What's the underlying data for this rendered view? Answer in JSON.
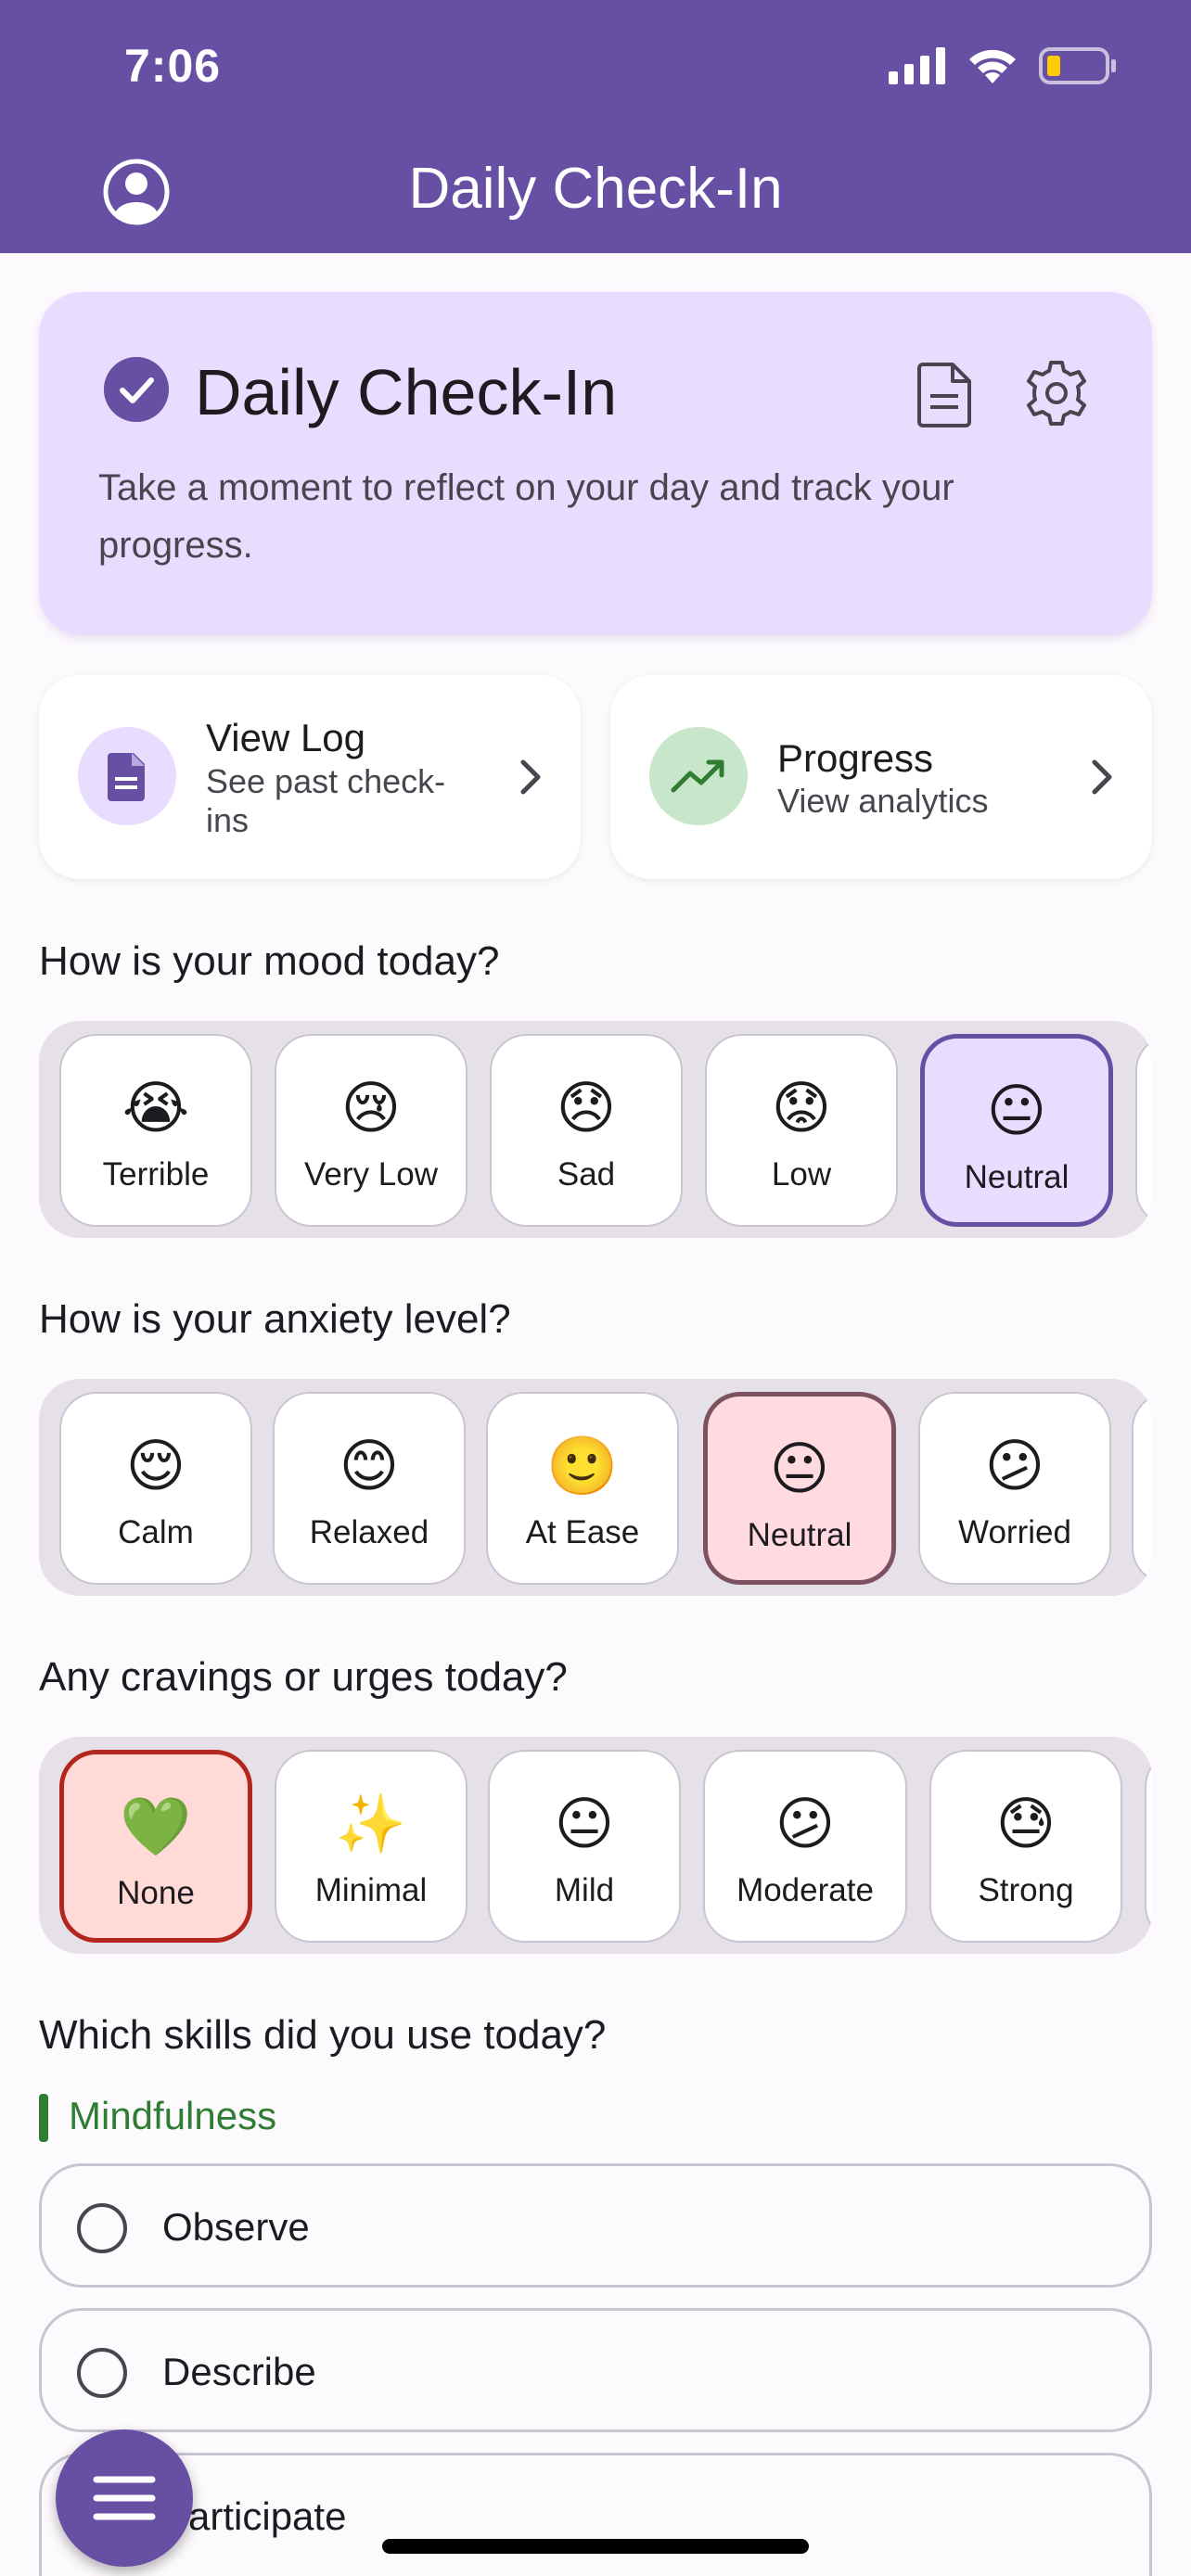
{
  "status": {
    "time": "7:06"
  },
  "header": {
    "title": "Daily Check-In"
  },
  "hero": {
    "title": "Daily Check-In",
    "description": "Take a moment to reflect on your day and track your progress."
  },
  "nav_cards": [
    {
      "title": "View Log",
      "subtitle": "See past check-ins"
    },
    {
      "title": "Progress",
      "subtitle": "View analytics"
    }
  ],
  "mood": {
    "question": "How is your mood today?",
    "options": [
      {
        "emoji": "😭",
        "label": "Terrible"
      },
      {
        "emoji": "😢",
        "label": "Very Low"
      },
      {
        "emoji": "😞",
        "label": "Sad"
      },
      {
        "emoji": "😟",
        "label": "Low"
      },
      {
        "emoji": "😐",
        "label": "Neutral"
      }
    ],
    "selected": "Neutral"
  },
  "anxiety": {
    "question": "How is your anxiety level?",
    "options": [
      {
        "emoji": "😌",
        "label": "Calm"
      },
      {
        "emoji": "😊",
        "label": "Relaxed"
      },
      {
        "emoji": "🙂",
        "label": "At Ease"
      },
      {
        "emoji": "😐",
        "label": "Neutral"
      },
      {
        "emoji": "😕",
        "label": "Worried"
      }
    ],
    "selected": "Neutral"
  },
  "cravings": {
    "question": "Any cravings or urges today?",
    "options": [
      {
        "emoji": "💚",
        "label": "None"
      },
      {
        "emoji": "✨",
        "label": "Minimal"
      },
      {
        "emoji": "😐",
        "label": "Mild"
      },
      {
        "emoji": "😕",
        "label": "Moderate"
      },
      {
        "emoji": "😓",
        "label": "Strong"
      }
    ],
    "selected": "None"
  },
  "skills": {
    "question": "Which skills did you use today?",
    "category": "Mindfulness",
    "items": [
      {
        "label": "Observe"
      },
      {
        "label": "Describe"
      },
      {
        "label": "Participate"
      }
    ]
  },
  "colors": {
    "primary": "#6750a4",
    "hero_bg": "#e9ddff",
    "success": "#2e7d32",
    "error": "#b3261e"
  }
}
